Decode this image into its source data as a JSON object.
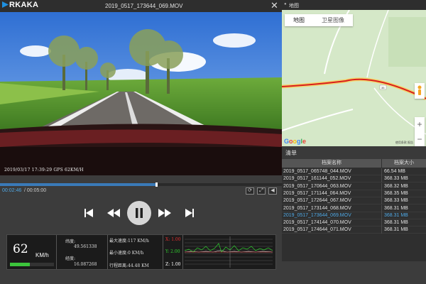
{
  "app": {
    "logo": "RKAKA",
    "file_title": "2019_0517_173644_069.MOV",
    "close_icon": "close-icon"
  },
  "video": {
    "overlay": "2019/03/17  17:39:29  GPS  62KM/H"
  },
  "playback": {
    "current_time": "00:02:46",
    "total_time": " / 00:05:00",
    "progress_fraction": 0.553
  },
  "tools": [
    {
      "name": "rotate-icon",
      "glyph": "⟳"
    },
    {
      "name": "fullscreen-icon",
      "glyph": "⤢"
    },
    {
      "name": "volume-icon",
      "glyph": "🔈"
    }
  ],
  "controls": {
    "prev": "skip-back-icon",
    "rewind": "rewind-icon",
    "play": "pause-icon",
    "forward": "fast-forward-icon",
    "next": "skip-forward-icon"
  },
  "telemetry": {
    "speed": "62",
    "speed_unit": "KM/h",
    "speed_fraction": 0.45,
    "lat_label": "纬度:",
    "lat_value": "49.561338",
    "lon_label": "经度:",
    "lon_value": "16.087268",
    "max_speed": "最大速度:117 KM/h",
    "min_speed": "最小速度:0 KM/h",
    "distance": "行程距离:44.48 KM",
    "x_axis": "X: 1.00",
    "y_axis": "Y: 2.00",
    "z_axis": "Z: 1.00",
    "colors": {
      "x": "#e03030",
      "y": "#30d030",
      "z": "#ffffff"
    }
  },
  "map": {
    "header": "地图",
    "tab_map": "地图",
    "tab_satellite": "卫星图像",
    "google": "Google",
    "attribution": "使用条款  报告",
    "road_label": "35",
    "colors": {
      "route": "#d81e1e",
      "land": "#d5e8c8"
    }
  },
  "list": {
    "title": "清单",
    "col_name": "档案名称",
    "col_size": "档案大小",
    "selected_index": 6,
    "rows": [
      {
        "name": "2019_0517_065748_044.MOV",
        "size": "66.54 MB"
      },
      {
        "name": "2019_0517_161144_052.MOV",
        "size": "368.33 MB"
      },
      {
        "name": "2019_0517_170644_063.MOV",
        "size": "368.32 MB"
      },
      {
        "name": "2019_0517_171144_064.MOV",
        "size": "368.35 MB"
      },
      {
        "name": "2019_0517_172644_067.MOV",
        "size": "368.33 MB"
      },
      {
        "name": "2019_0517_173144_068.MOV",
        "size": "368.31 MB"
      },
      {
        "name": "2019_0517_173644_069.MOV",
        "size": "368.31 MB"
      },
      {
        "name": "2019_0517_174144_070.MOV",
        "size": "368.31 MB"
      },
      {
        "name": "2019_0517_174644_071.MOV",
        "size": "368.31 MB"
      }
    ]
  }
}
